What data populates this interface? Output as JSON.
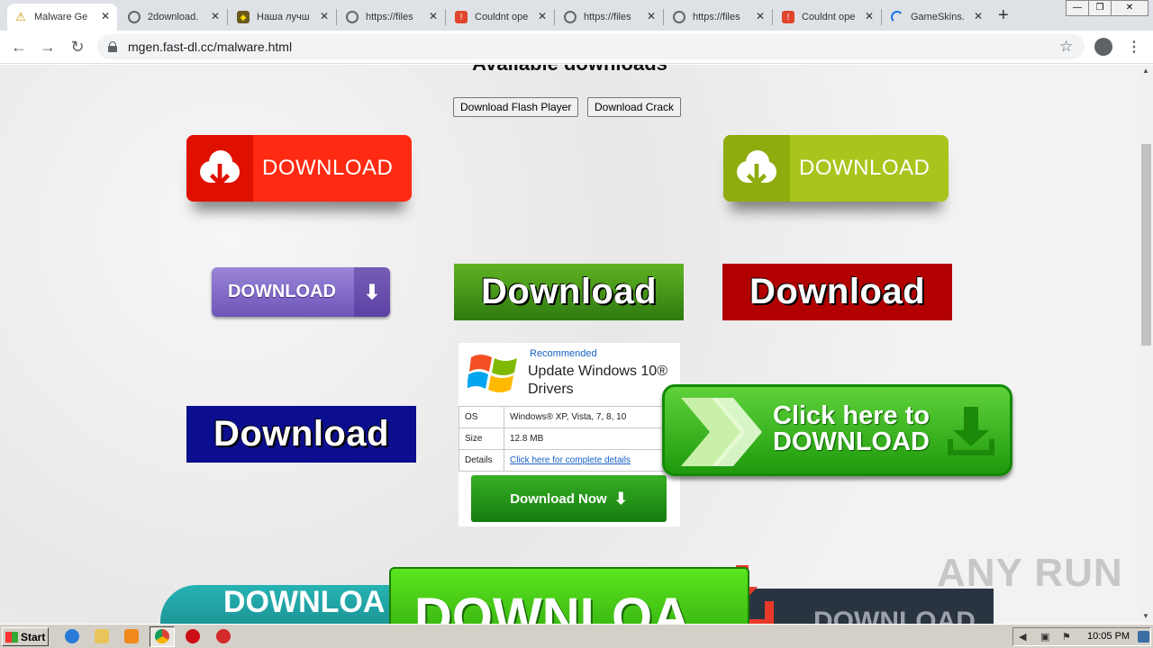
{
  "tabs": [
    {
      "title": "Malware Ge",
      "favicon": "warning-icon",
      "active": true
    },
    {
      "title": "2download.",
      "favicon": "globe-icon"
    },
    {
      "title": "Наша лучш",
      "favicon": "shield-icon"
    },
    {
      "title": "https://files",
      "favicon": "globe-icon"
    },
    {
      "title": "Couldnt ope",
      "favicon": "broken-page-icon"
    },
    {
      "title": "https://files",
      "favicon": "globe-icon"
    },
    {
      "title": "https://files",
      "favicon": "globe-icon"
    },
    {
      "title": "Couldnt ope",
      "favicon": "broken-page-icon"
    },
    {
      "title": "GameSkins.",
      "favicon": "loading-icon"
    }
  ],
  "toolbar": {
    "url": "mgen.fast-dl.cc/malware.html"
  },
  "page": {
    "heading": "Available downloads",
    "btn_flash": "Download Flash Player",
    "btn_crack": "Download Crack",
    "cloud_red_label": "DOWNLOAD",
    "cloud_green_label": "DOWNLOAD",
    "purple_label": "DOWNLOAD",
    "green_label": "Download",
    "red_label": "Download",
    "navy_label": "Download",
    "ad": {
      "recommended": "Recommended",
      "title": "Update Windows 10® Drivers",
      "rows": [
        {
          "key": "OS",
          "value": "Windows® XP, Vista, 7, 8, 10"
        },
        {
          "key": "Size",
          "value": "12.8 MB"
        },
        {
          "key": "Details",
          "value": "Click here for complete details"
        }
      ],
      "button": "Download Now"
    },
    "click_here_line1": "Click here to",
    "click_here_line2": "DOWNLOAD",
    "bottom_teal": "DOWNLOA",
    "bottom_green": "DOWNLOA",
    "bottom_dark": "DOWNLOAD",
    "watermark": "ANY RUN"
  },
  "taskbar": {
    "start": "Start",
    "time": "10:05 PM"
  },
  "colors": {
    "cloud_red": "#ff2a12",
    "cloud_green": "#a8c51d",
    "green": "#4c9e1a",
    "red": "#b20000",
    "navy": "#0b0e8e",
    "purple": "#8470cc"
  }
}
